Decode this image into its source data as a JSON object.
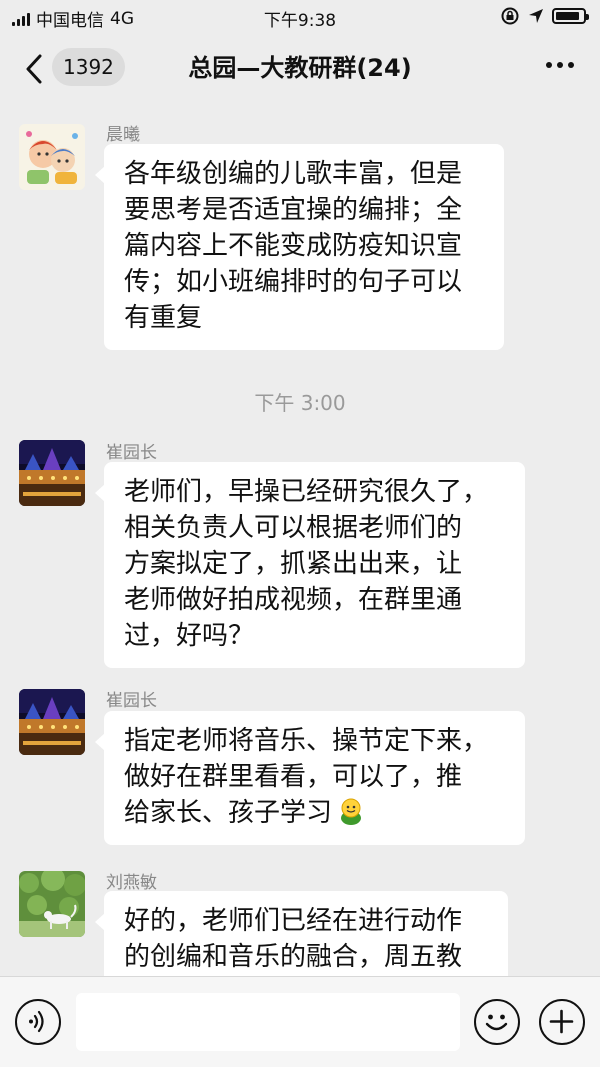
{
  "status_bar": {
    "carrier": "中国电信",
    "network": "4G",
    "time": "下午9:38",
    "battery_level": 0.9
  },
  "nav": {
    "unread_count": "1392",
    "title": "总园—大教研群(24)"
  },
  "messages": [
    {
      "sender": "晨曦",
      "lines": [
        "各年级创编的儿歌丰富，但是",
        "要思考是否适宜操的编排；全",
        "篇内容上不能变成防疫知识宣",
        "传；如小班编排时的句子可以",
        "有重复"
      ]
    },
    {
      "sender": "崔园长",
      "lines": [
        "老师们，早操已经研究很久了，",
        "相关负责人可以根据老师们的",
        "方案拟定了，抓紧出出来，让",
        "老师做好拍成视频，在群里通",
        "过，好吗？"
      ]
    },
    {
      "sender": "崔园长",
      "lines": [
        "指定老师将音乐、操节定下来，",
        "做好在群里看看，可以了，推",
        "给家长、孩子学习"
      ],
      "emoji": "smiling-face-emoji"
    },
    {
      "sender": "刘燕敏",
      "lines": [
        "好的，老师们已经在进行动作",
        "的创编和音乐的融合，周五教"
      ]
    }
  ],
  "time_divider": "下午 3:00",
  "input": {
    "value": "",
    "placeholder": ""
  },
  "icons": {
    "back": "chevron-left-icon",
    "more": "more-dots-icon",
    "voice": "voice-icon",
    "emoji": "emoji-icon",
    "add": "plus-icon"
  },
  "colors": {
    "background": "#ededed",
    "bubble": "#ffffff",
    "sender_name": "#888888",
    "time_divider": "#9a9a9a"
  }
}
